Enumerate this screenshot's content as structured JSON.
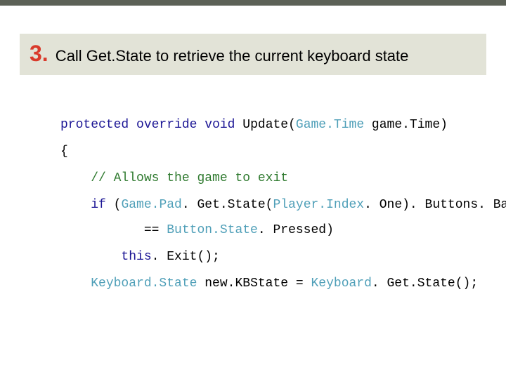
{
  "heading": {
    "number": "3.",
    "text": " Call Get.State to retrieve the current keyboard state"
  },
  "code": {
    "l1a": "protected",
    "l1b": " ",
    "l1c": "override",
    "l1d": " ",
    "l1e": "void",
    "l1f": " Update(",
    "l1g": "Game.Time",
    "l1h": " game.Time)",
    "l2": "{",
    "l3a": "    ",
    "l3b": "// Allows the game to exit",
    "l4a": "    ",
    "l4b": "if",
    "l4c": " (",
    "l4d": "Game.Pad",
    "l4e": ". Get.State(",
    "l4f": "Player.Index",
    "l4g": ". One). Buttons. Back",
    "l5a": "           == ",
    "l5b": "Button.State",
    "l5c": ". Pressed)",
    "l6a": "        ",
    "l6b": "this",
    "l6c": ". Exit();",
    "l7a": "    ",
    "l7b": "Keyboard.State",
    "l7c": " new.KBState = ",
    "l7d": "Keyboard",
    "l7e": ". Get.State();"
  }
}
